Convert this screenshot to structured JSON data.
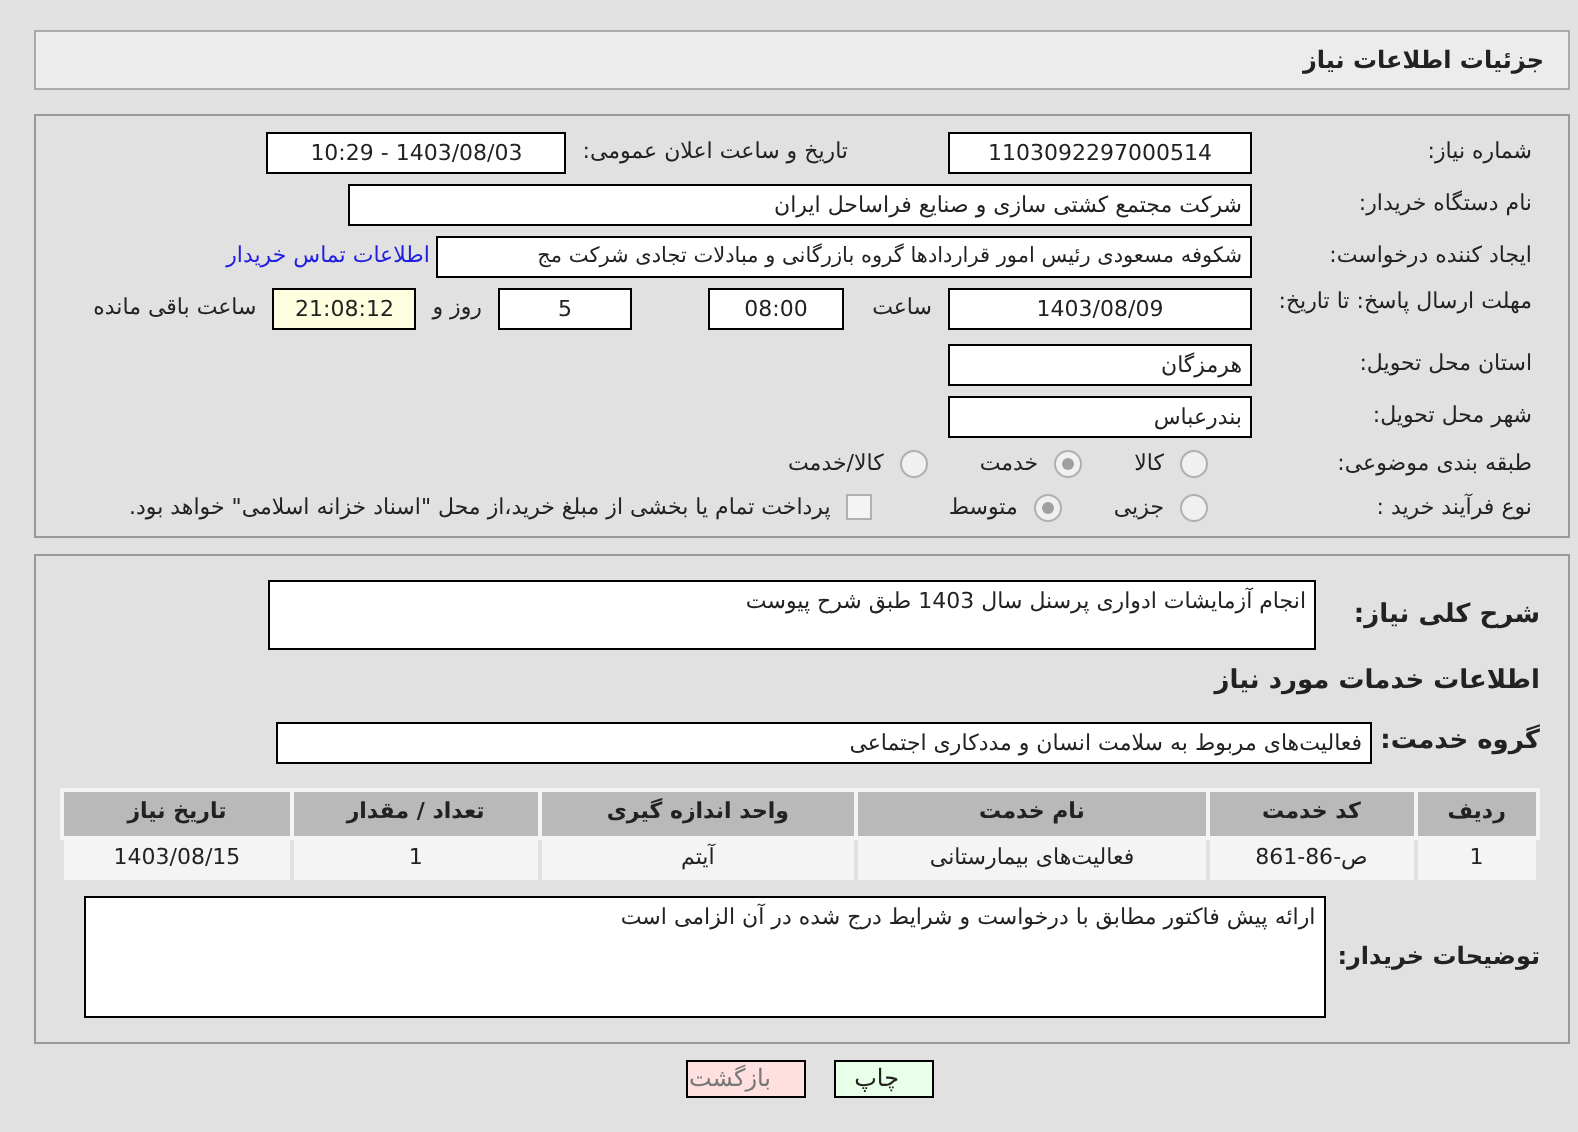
{
  "header": {
    "title": "جزئیات اطلاعات نیاز"
  },
  "details": {
    "need_number": {
      "label": "شماره نیاز:",
      "value": "1103092297000514"
    },
    "announce": {
      "label": "تاریخ و ساعت اعلان عمومی:",
      "value": "1403/08/03 - 10:29"
    },
    "buyer": {
      "label": "نام دستگاه خریدار:",
      "value": "شرکت مجتمع کشتی سازی و صنایع فراساحل ایران"
    },
    "creator": {
      "label": "ایجاد کننده درخواست:",
      "value": "شکوفه مسعودی رئیس امور قراردادها گروه بازرگانی و مبادلات تجادی شرکت مج",
      "link": "اطلاعات تماس خریدار"
    },
    "deadline": {
      "label": "مهلت ارسال پاسخ: تا تاریخ:",
      "date": "1403/08/09",
      "time_label": "ساعت",
      "time": "08:00",
      "days": "5",
      "days_label": "روز و",
      "remaining": "21:08:12",
      "remaining_label": "ساعت باقی مانده"
    },
    "province": {
      "label": "استان محل تحویل:",
      "value": "هرمزگان"
    },
    "city": {
      "label": "شهر محل تحویل:",
      "value": "بندرعباس"
    },
    "category": {
      "label": "طبقه بندی موضوعی:",
      "options": [
        {
          "label": "کالا",
          "selected": false
        },
        {
          "label": "خدمت",
          "selected": true
        },
        {
          "label": "کالا/خدمت",
          "selected": false
        }
      ]
    },
    "process": {
      "label": "نوع فرآیند خرید :",
      "options": [
        {
          "label": "جزیی",
          "selected": false
        },
        {
          "label": "متوسط",
          "selected": true
        }
      ],
      "treasury": {
        "checked": false,
        "label": "پرداخت تمام یا بخشی از مبلغ خرید،از محل \"اسناد خزانه اسلامی\" خواهد بود."
      }
    }
  },
  "services": {
    "summary": {
      "label": "شرح کلی نیاز:",
      "value": "انجام آزمایشات ادواری پرسنل سال 1403 طبق شرح پیوست"
    },
    "heading": "اطلاعات خدمات مورد نیاز",
    "group": {
      "label": "گروه خدمت:",
      "value": "فعالیت‌های مربوط به سلامت انسان و مددکاری اجتماعی"
    },
    "table": {
      "columns": [
        "ردیف",
        "کد خدمت",
        "نام خدمت",
        "واحد اندازه گیری",
        "تعداد / مقدار",
        "تاریخ نیاز"
      ],
      "rows": [
        [
          "1",
          "ص-86-861",
          "فعالیت‌های بیمارستانی",
          "آیتم",
          "1",
          "1403/08/15"
        ]
      ]
    },
    "notes": {
      "label": "توضیحات خریدار:",
      "value": "ارائه پیش فاکتور مطابق با درخواست و شرایط درج شده در آن الزامی است"
    }
  },
  "buttons": [
    {
      "label": "چاپ",
      "kind": "print"
    },
    {
      "label": "بازگشت",
      "kind": "back"
    }
  ]
}
